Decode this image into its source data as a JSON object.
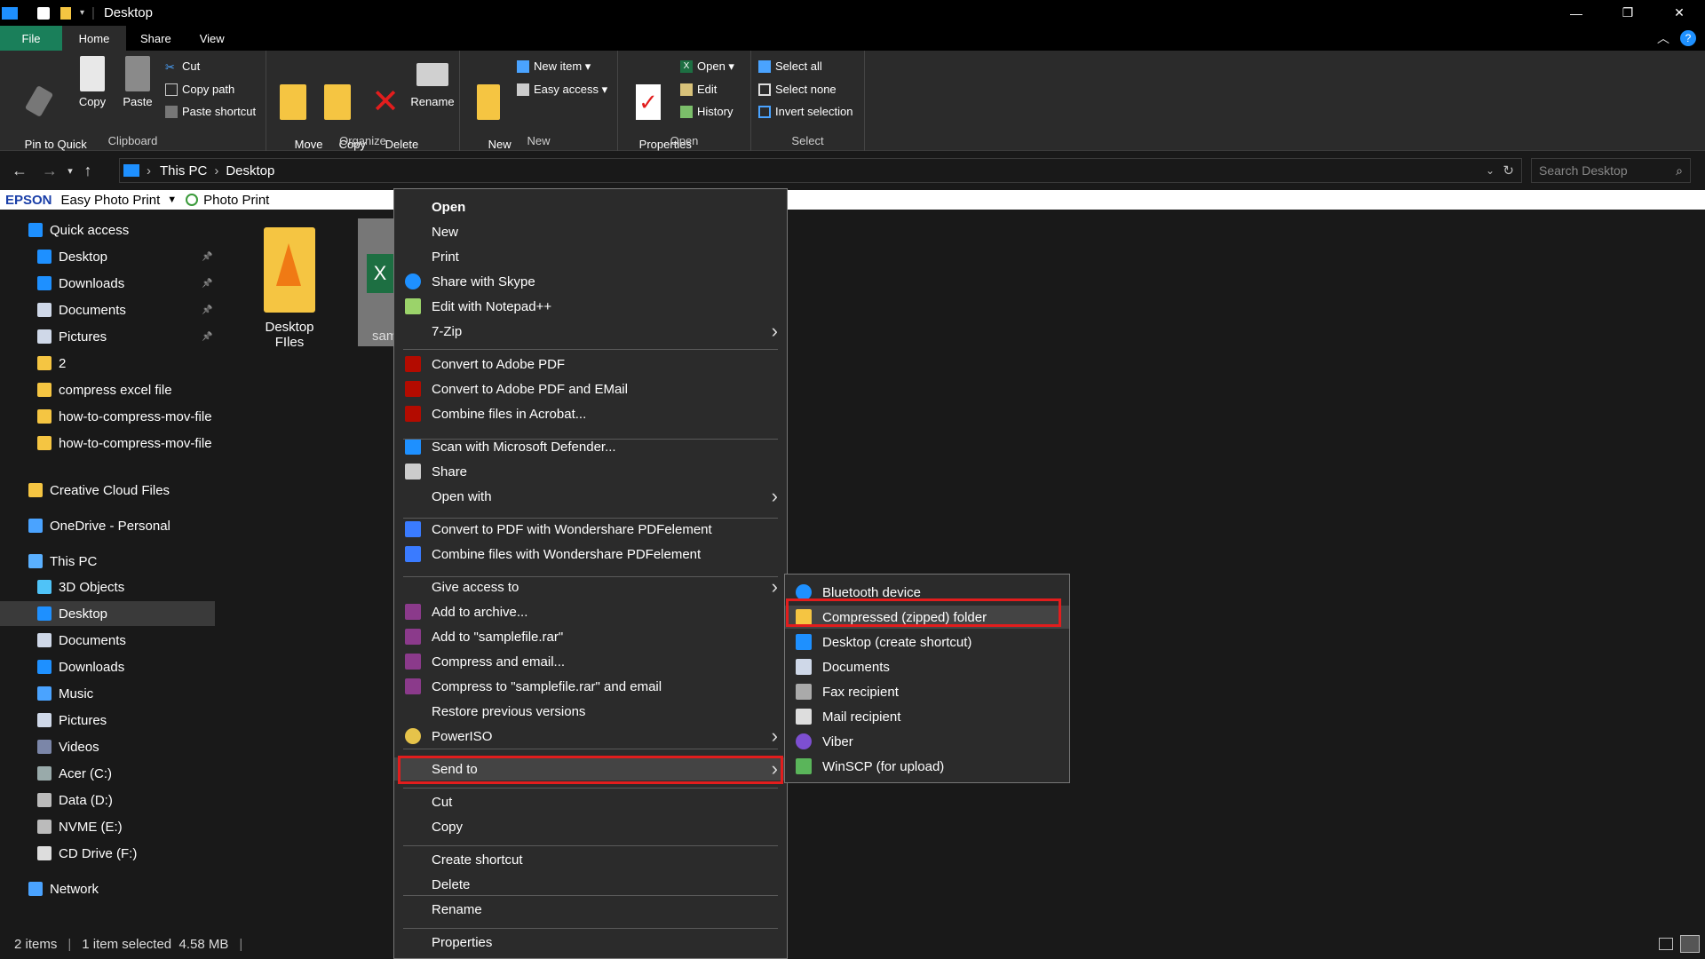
{
  "window": {
    "title": "Desktop",
    "min": "—",
    "max": "❐",
    "close": "✕"
  },
  "tabs": [
    "File",
    "Home",
    "Share",
    "View"
  ],
  "ribbon": {
    "clipboard": {
      "label": "Clipboard",
      "pin": "Pin to Quick\naccess",
      "copy": "Copy",
      "paste": "Paste",
      "cut": "Cut",
      "copy_path": "Copy path",
      "paste_shortcut": "Paste shortcut"
    },
    "organize": {
      "label": "Organize",
      "move_to": "Move\nto ▾",
      "copy_to": "Copy\nto ▾",
      "delete": "Delete\n▾",
      "rename": "Rename"
    },
    "new": {
      "label": "New",
      "new_folder": "New\nfolder",
      "new_item": "New item ▾",
      "easy_access": "Easy access ▾"
    },
    "open": {
      "label": "Open",
      "properties": "Properties\n▾",
      "open": "Open ▾",
      "edit": "Edit",
      "history": "History"
    },
    "select": {
      "label": "Select",
      "select_all": "Select all",
      "select_none": "Select none",
      "invert": "Invert selection"
    }
  },
  "address": {
    "crumbs": [
      "This PC",
      "Desktop"
    ],
    "search_placeholder": "Search Desktop"
  },
  "epson": {
    "brand": "EPSON",
    "app": "Easy Photo Print",
    "photo": "Photo Print"
  },
  "sidebar": {
    "quick_access": "Quick access",
    "quick_items": [
      "Desktop",
      "Downloads",
      "Documents",
      "Pictures",
      "2",
      "compress excel file",
      "how-to-compress-mov-file",
      "how-to-compress-mov-file"
    ],
    "creative_cloud": "Creative Cloud Files",
    "onedrive": "OneDrive - Personal",
    "this_pc": "This PC",
    "pc_items": [
      "3D Objects",
      "Desktop",
      "Documents",
      "Downloads",
      "Music",
      "Pictures",
      "Videos",
      "Acer (C:)",
      "Data (D:)",
      "NVME (E:)",
      "CD Drive (F:)"
    ],
    "network": "Network"
  },
  "files": [
    {
      "name": "Desktop FIles"
    },
    {
      "name": "sam"
    }
  ],
  "context_menu": {
    "items": [
      "Open",
      "New",
      "Print",
      "Share with Skype",
      "Edit with Notepad++",
      "7-Zip",
      "Convert to Adobe PDF",
      "Convert to Adobe PDF and EMail",
      "Combine files in Acrobat...",
      "Scan with Microsoft Defender...",
      "Share",
      "Open with",
      "Convert to PDF with Wondershare PDFelement",
      "Combine files with Wondershare PDFelement",
      "Give access to",
      "Add to archive...",
      "Add to \"samplefile.rar\"",
      "Compress and email...",
      "Compress to \"samplefile.rar\" and email",
      "Restore previous versions",
      "PowerISO",
      "Send to",
      "Cut",
      "Copy",
      "Create shortcut",
      "Delete",
      "Rename",
      "Properties"
    ]
  },
  "send_to_menu": {
    "items": [
      "Bluetooth device",
      "Compressed (zipped) folder",
      "Desktop (create shortcut)",
      "Documents",
      "Fax recipient",
      "Mail recipient",
      "Viber",
      "WinSCP (for upload)"
    ]
  },
  "status": {
    "count": "2 items",
    "selected": "1 item selected  4.58 MB"
  },
  "colors": {
    "accent": "#1a7f5a",
    "highlight": "#e21d1d",
    "folder": "#f5c542"
  }
}
